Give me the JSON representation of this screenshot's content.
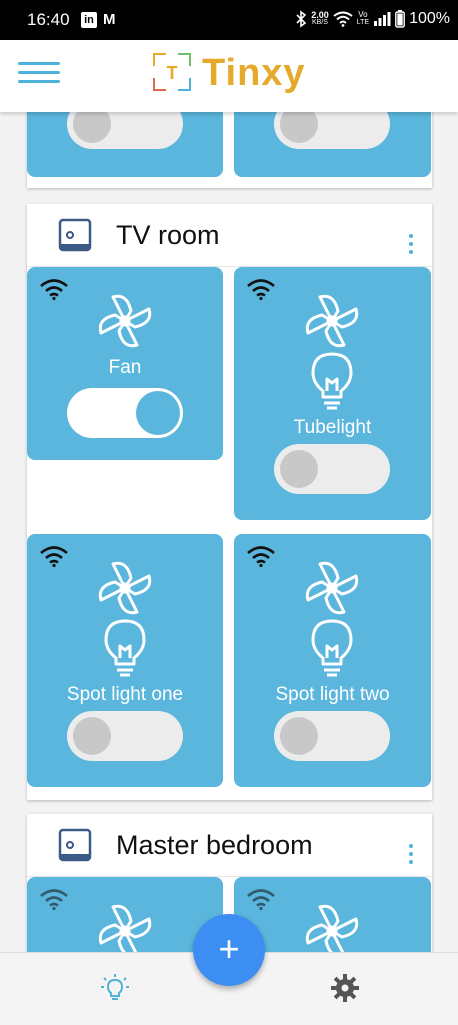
{
  "status_bar": {
    "time": "16:40",
    "linkedin": "in",
    "mail": "M",
    "net_speed_top": "2.00",
    "net_speed_bottom": "KB/S",
    "volte_top": "Vo",
    "volte_bottom": "LTE",
    "battery": "100%"
  },
  "header": {
    "logo_letter": "T",
    "app_name": "Tinxy",
    "accent": "#e5a92c",
    "menu_icon": "hamburger-icon"
  },
  "rooms": [
    {
      "title": "TV room",
      "devices": [
        {
          "name": "Fan",
          "state": "on",
          "icons": [
            "fan-icon"
          ]
        },
        {
          "name": "Tubelight",
          "state": "off",
          "icons": [
            "fan-icon",
            "bulb-icon"
          ]
        },
        {
          "name": "Spot light one",
          "state": "off",
          "icons": [
            "fan-icon",
            "bulb-icon"
          ]
        },
        {
          "name": "Spot light two",
          "state": "off",
          "icons": [
            "fan-icon",
            "bulb-icon"
          ]
        }
      ]
    },
    {
      "title": "Master bedroom"
    }
  ],
  "fab": {
    "label": "+"
  },
  "bottom_nav": {
    "left_icon": "bulb-icon",
    "right_icon": "gear-icon"
  },
  "colors": {
    "tile": "#5ab6dc",
    "fab": "#3d8ef2",
    "menu": "#4fb2d8"
  }
}
